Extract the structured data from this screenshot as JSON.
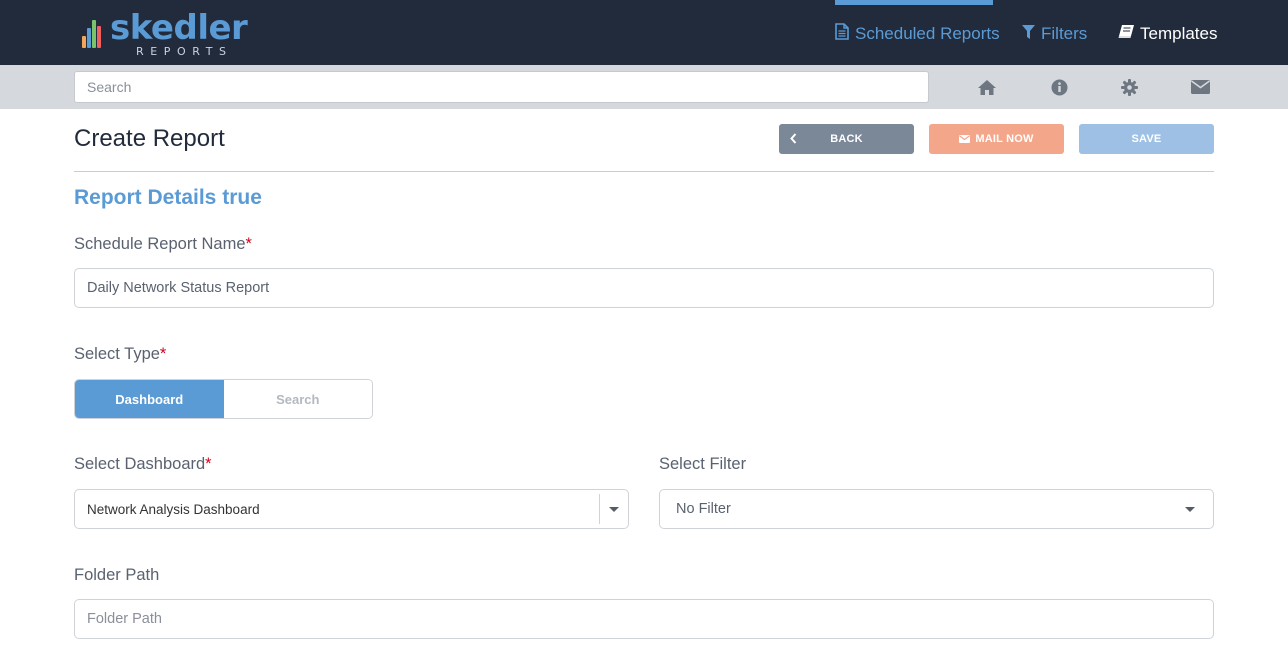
{
  "brand": {
    "name": "skedler",
    "subtitle": "REPORTS",
    "bar_colors": [
      "#f2a65a",
      "#5b9bd5",
      "#7ac36a",
      "#f25f5c",
      "#5b9bd5"
    ]
  },
  "nav": {
    "scheduled_reports": "Scheduled Reports",
    "filters": "Filters",
    "templates": "Templates",
    "active_color": "#5b9bd5"
  },
  "toolbar": {
    "search_placeholder": "Search",
    "icons": [
      "home-icon",
      "info-icon",
      "gear-icon",
      "envelope-icon"
    ]
  },
  "page": {
    "title": "Create Report",
    "back_label": "BACK",
    "mail_now_label": "MAIL NOW",
    "save_label": "SAVE"
  },
  "form": {
    "section_title": "Report Details true",
    "report_name": {
      "label": "Schedule Report Name",
      "required_mark": "*",
      "value": "Daily Network Status Report"
    },
    "select_type": {
      "label": "Select Type",
      "required_mark": "*",
      "options": [
        "Dashboard",
        "Search"
      ],
      "selected": "Dashboard"
    },
    "select_dashboard": {
      "label": "Select Dashboard",
      "required_mark": "*",
      "value": "Network Analysis Dashboard"
    },
    "select_filter": {
      "label": "Select Filter",
      "value": "No Filter"
    },
    "folder_path": {
      "label": "Folder Path",
      "placeholder": "Folder Path"
    }
  }
}
